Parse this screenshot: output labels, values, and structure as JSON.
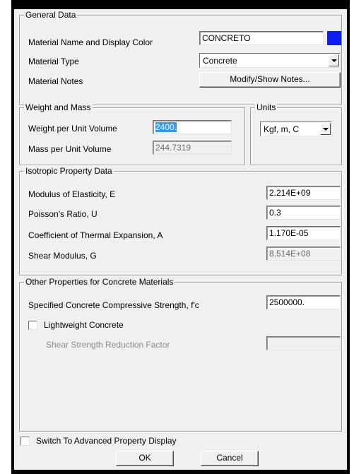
{
  "colors": {
    "display_color": "#0a1ef5",
    "dialog_bg": "#f0f0f0",
    "selection": "#3399ff"
  },
  "general": {
    "title": "General Data",
    "name_label": "Material Name and Display Color",
    "name_value": "CONCRETO",
    "type_label": "Material Type",
    "type_value": "Concrete",
    "notes_label": "Material Notes",
    "notes_button": "Modify/Show Notes..."
  },
  "weight": {
    "title": "Weight and Mass",
    "weight_label": "Weight per Unit Volume",
    "weight_value": "2400.",
    "mass_label": "Mass per Unit Volume",
    "mass_value": "244.7319"
  },
  "units": {
    "title": "Units",
    "value": "Kgf, m, C"
  },
  "isotropic": {
    "title": "Isotropic Property Data",
    "modulus_label": "Modulus of Elasticity,  E",
    "modulus_value": "2.214E+09",
    "poisson_label": "Poisson's Ratio,  U",
    "poisson_value": "0.3",
    "thermal_label": "Coefficient of Thermal Expansion,  A",
    "thermal_value": "1.170E-05",
    "shear_label": "Shear Modulus,  G",
    "shear_value": "8.514E+08"
  },
  "concrete": {
    "title": "Other Properties for Concrete Materials",
    "fc_label": "Specified Concrete Compressive Strength, f'c",
    "fc_value": "2500000.",
    "lightweight_label": "Lightweight Concrete",
    "lightweight_checked": false,
    "reduction_label": "Shear Strength Reduction Factor",
    "reduction_value": ""
  },
  "footer": {
    "advanced_label": "Switch To Advanced Property Display",
    "advanced_checked": false,
    "ok_label": "OK",
    "cancel_label": "Cancel"
  }
}
